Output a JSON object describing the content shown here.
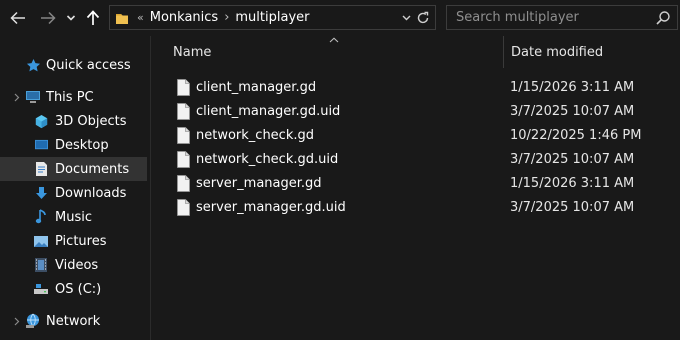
{
  "toolbar": {
    "back_icon": "arrow-left-icon",
    "forward_icon": "arrow-right-icon",
    "recent_icon": "chevron-down-icon",
    "up_icon": "arrow-up-icon"
  },
  "address": {
    "overflow": "«",
    "crumbs": [
      "Monkanics",
      "multiplayer"
    ],
    "separator": "›"
  },
  "search": {
    "placeholder": "Search multiplayer",
    "value": ""
  },
  "sidebar": {
    "items": [
      {
        "label": "Quick access",
        "icon": "star-icon"
      },
      {
        "label": "This PC",
        "icon": "computer-icon"
      },
      {
        "label": "3D Objects",
        "icon": "cube-icon"
      },
      {
        "label": "Desktop",
        "icon": "desktop-icon"
      },
      {
        "label": "Documents",
        "icon": "document-icon",
        "selected": true
      },
      {
        "label": "Downloads",
        "icon": "download-icon"
      },
      {
        "label": "Music",
        "icon": "music-note-icon"
      },
      {
        "label": "Pictures",
        "icon": "picture-icon"
      },
      {
        "label": "Videos",
        "icon": "film-icon"
      },
      {
        "label": "OS (C:)",
        "icon": "drive-icon"
      },
      {
        "label": "Network",
        "icon": "network-icon"
      }
    ]
  },
  "columns": {
    "name": "Name",
    "date": "Date modified"
  },
  "files": [
    {
      "name": "client_manager.gd",
      "date": "1/15/2026 3:11 AM"
    },
    {
      "name": "client_manager.gd.uid",
      "date": "3/7/2025 10:07 AM"
    },
    {
      "name": "network_check.gd",
      "date": "10/22/2025 1:46 PM"
    },
    {
      "name": "network_check.gd.uid",
      "date": "3/7/2025 10:07 AM"
    },
    {
      "name": "server_manager.gd",
      "date": "1/15/2026 3:11 AM"
    },
    {
      "name": "server_manager.gd.uid",
      "date": "3/7/2025 10:07 AM"
    }
  ],
  "colors": {
    "background": "#191919",
    "selected": "#333333",
    "accent_blue": "#3a96dd",
    "folder_yellow": "#f0c050"
  }
}
